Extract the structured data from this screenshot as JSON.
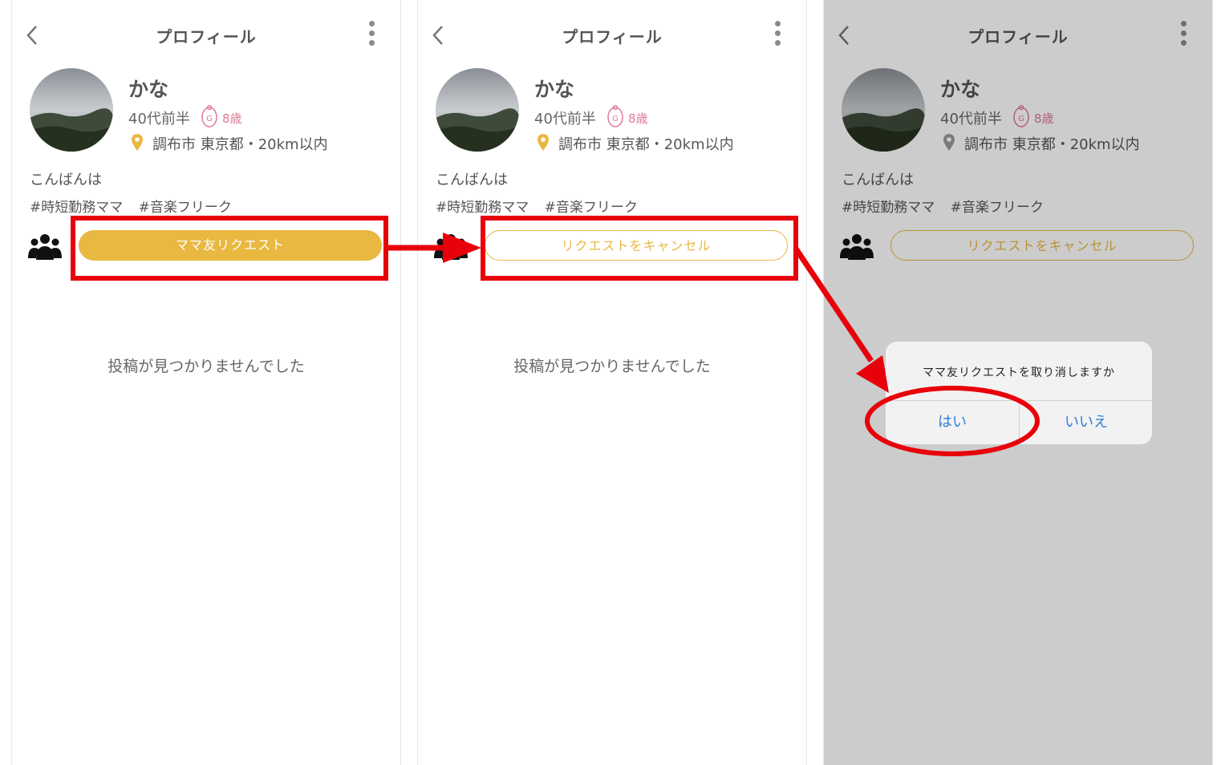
{
  "screens": [
    {
      "title": "プロフィール",
      "name": "かな",
      "age": "40代前半",
      "child_age": "8歳",
      "location": "調布市 東京都・20km以内",
      "greeting": "こんばんは",
      "tags": [
        "#時短勤務ママ",
        "#音楽フリーク"
      ],
      "request_button": "ママ友リクエスト",
      "empty_message": "投稿が見つかりませんでした"
    },
    {
      "title": "プロフィール",
      "name": "かな",
      "age": "40代前半",
      "child_age": "8歳",
      "location": "調布市 東京都・20km以内",
      "greeting": "こんばんは",
      "tags": [
        "#時短勤務ママ",
        "#音楽フリーク"
      ],
      "request_button": "リクエストをキャンセル",
      "empty_message": "投稿が見つかりませんでした"
    },
    {
      "title": "プロフィール",
      "name": "かな",
      "age": "40代前半",
      "child_age": "8歳",
      "location": "調布市 東京都・20km以内",
      "greeting": "こんばんは",
      "tags": [
        "#時短勤務ママ",
        "#音楽フリーク"
      ],
      "request_button": "リクエストをキャンセル",
      "dialog": {
        "message": "ママ友リクエストを取り消しますか",
        "yes": "はい",
        "no": "いいえ"
      }
    }
  ],
  "colors": {
    "accent": "#e8b841",
    "annotation": "#e8000b",
    "dialog_button": "#2f7ed9",
    "child_badge": "#e07a95"
  }
}
